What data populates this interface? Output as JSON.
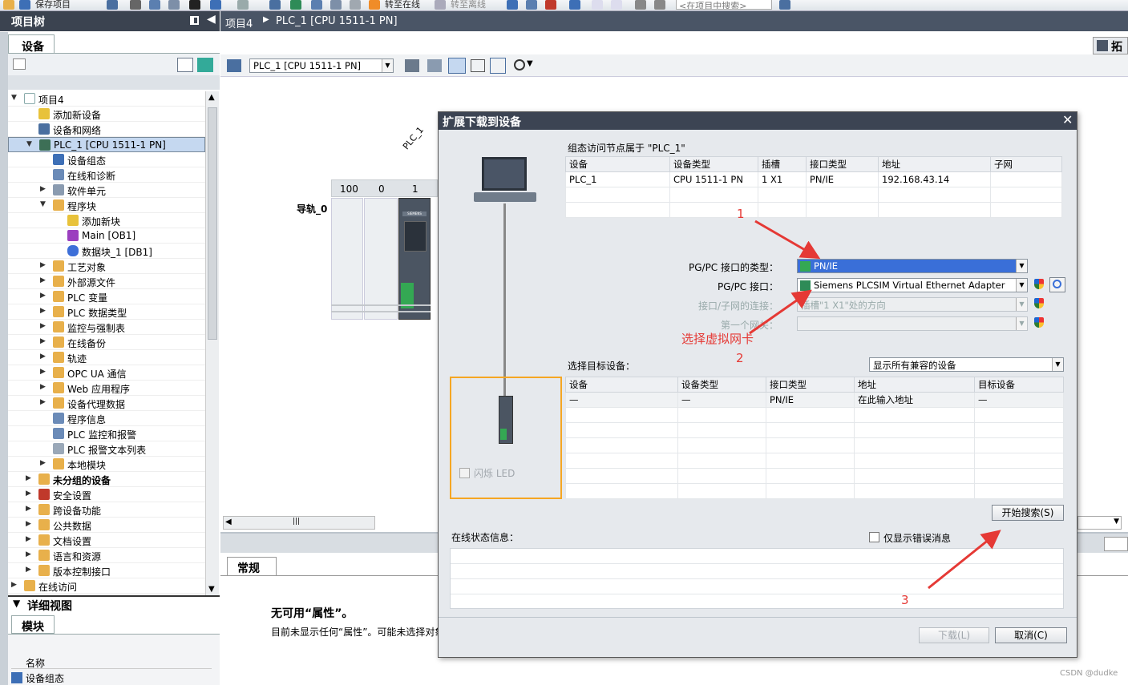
{
  "toolbar": {
    "save_label": "保存项目",
    "go_online": "转至在线",
    "go_offline": "转至离线",
    "search_placeholder": "<在项目中搜索>"
  },
  "tree": {
    "title": "项目树",
    "tab": "设备",
    "items": [
      {
        "label": "项目4"
      },
      {
        "label": "添加新设备"
      },
      {
        "label": "设备和网络"
      },
      {
        "label": "PLC_1 [CPU 1511-1 PN]"
      },
      {
        "label": "设备组态"
      },
      {
        "label": "在线和诊断"
      },
      {
        "label": "软件单元"
      },
      {
        "label": "程序块"
      },
      {
        "label": "添加新块"
      },
      {
        "label": "Main [OB1]"
      },
      {
        "label": "数据块_1 [DB1]"
      },
      {
        "label": "工艺对象"
      },
      {
        "label": "外部源文件"
      },
      {
        "label": "PLC 变量"
      },
      {
        "label": "PLC 数据类型"
      },
      {
        "label": "监控与强制表"
      },
      {
        "label": "在线备份"
      },
      {
        "label": "轨迹"
      },
      {
        "label": "OPC UA 通信"
      },
      {
        "label": "Web 应用程序"
      },
      {
        "label": "设备代理数据"
      },
      {
        "label": "程序信息"
      },
      {
        "label": "PLC 监控和报警"
      },
      {
        "label": "PLC 报警文本列表"
      },
      {
        "label": "本地模块"
      },
      {
        "label": "未分组的设备"
      },
      {
        "label": "安全设置"
      },
      {
        "label": "跨设备功能"
      },
      {
        "label": "公共数据"
      },
      {
        "label": "文档设置"
      },
      {
        "label": "语言和资源"
      },
      {
        "label": "版本控制接口"
      },
      {
        "label": "在线访问"
      }
    ]
  },
  "detail": {
    "title": "详细视图",
    "tab": "模块",
    "col_name": "名称",
    "row1": "设备组态"
  },
  "main": {
    "breadcrumb_project": "项目4",
    "breadcrumb_device": "PLC_1 [CPU 1511-1 PN]",
    "device_select": "PLC_1 [CPU 1511-1 PN]",
    "topology_btn": "拓",
    "plc_label": "PLC_1",
    "rail_label": "导轨_0",
    "slot_headers": [
      "100",
      "0",
      "1"
    ],
    "module_brand": "SIEMENS",
    "props_tab": "常规",
    "props_title": "无可用“属性”。",
    "props_text": "目前未显示任何“属性”。可能未选择对象"
  },
  "dialog": {
    "title": "扩展下载到设备",
    "nodes_caption": "组态访问节点属于 \"PLC_1\"",
    "nodes_headers": [
      "设备",
      "设备类型",
      "插槽",
      "接口类型",
      "地址",
      "子网"
    ],
    "nodes_row": [
      "PLC_1",
      "CPU 1511-1 PN",
      "1 X1",
      "PN/IE",
      "192.168.43.14",
      ""
    ],
    "pgpc_type_label": "PG/PC 接口的类型：",
    "pgpc_type_value": "PN/IE",
    "pgpc_if_label": "PG/PC 接口：",
    "pgpc_if_value": "Siemens PLCSIM Virtual Ethernet Adapter",
    "subnet_conn_label": "接口/子网的连接：",
    "subnet_conn_value": "插槽\"1 X1\"处的方向",
    "gateway_label": "第一个网关：",
    "gateway_value": "",
    "target_label": "选择目标设备：",
    "target_filter": "显示所有兼容的设备",
    "target_headers": [
      "设备",
      "设备类型",
      "接口类型",
      "地址",
      "目标设备"
    ],
    "target_row": [
      "—",
      "—",
      "PN/IE",
      "在此输入地址",
      "—"
    ],
    "flash_led": "闪烁 LED",
    "search_btn": "开始搜索(S)",
    "status_label": "在线状态信息：",
    "errors_only": "仅显示错误消息",
    "download_btn": "下载(L)",
    "cancel_btn": "取消(C)"
  },
  "annotations": {
    "n1": "1",
    "n2": "2",
    "n3": "3",
    "hint": "选择虚拟网卡"
  },
  "watermark": "CSDN @dudke",
  "colors": {
    "accent": "#3a6fd8",
    "annotation": "#e53935",
    "highlight_box": "#f5a623",
    "title_bar": "#3c4453"
  }
}
